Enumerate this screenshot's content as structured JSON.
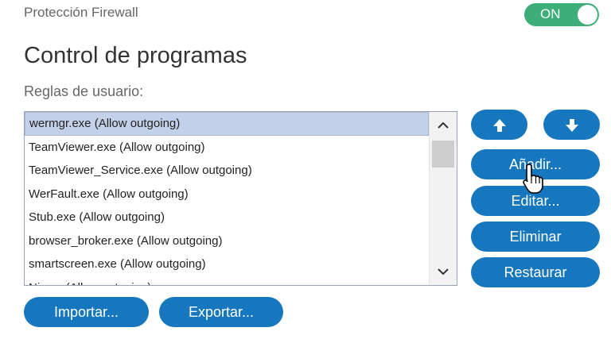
{
  "header": {
    "label": "Protección Firewall",
    "toggle_label": "ON"
  },
  "section": {
    "title": "Control de programas",
    "subtitle": "Reglas de usuario:"
  },
  "list": {
    "items": [
      "wermgr.exe (Allow outgoing)",
      "TeamViewer.exe (Allow outgoing)",
      "TeamViewer_Service.exe (Allow outgoing)",
      "WerFault.exe (Allow outgoing)",
      "Stub.exe (Allow outgoing)",
      "browser_broker.exe (Allow outgoing)",
      "smartscreen.exe (Allow outgoing)",
      "Ni.exe (Allow outgoing)"
    ],
    "selected_index": 0
  },
  "buttons": {
    "add": "Añadir...",
    "edit": "Editar...",
    "delete": "Eliminar",
    "restore": "Restaurar",
    "import": "Importar...",
    "export": "Exportar..."
  },
  "colors": {
    "accent": "#1677bf",
    "toggle_on": "#3cae78",
    "selection": "#c2d0ea"
  },
  "icons": {
    "move_up": "arrow-up-icon",
    "move_down": "arrow-down-icon",
    "pointer": "hand-cursor-icon"
  }
}
